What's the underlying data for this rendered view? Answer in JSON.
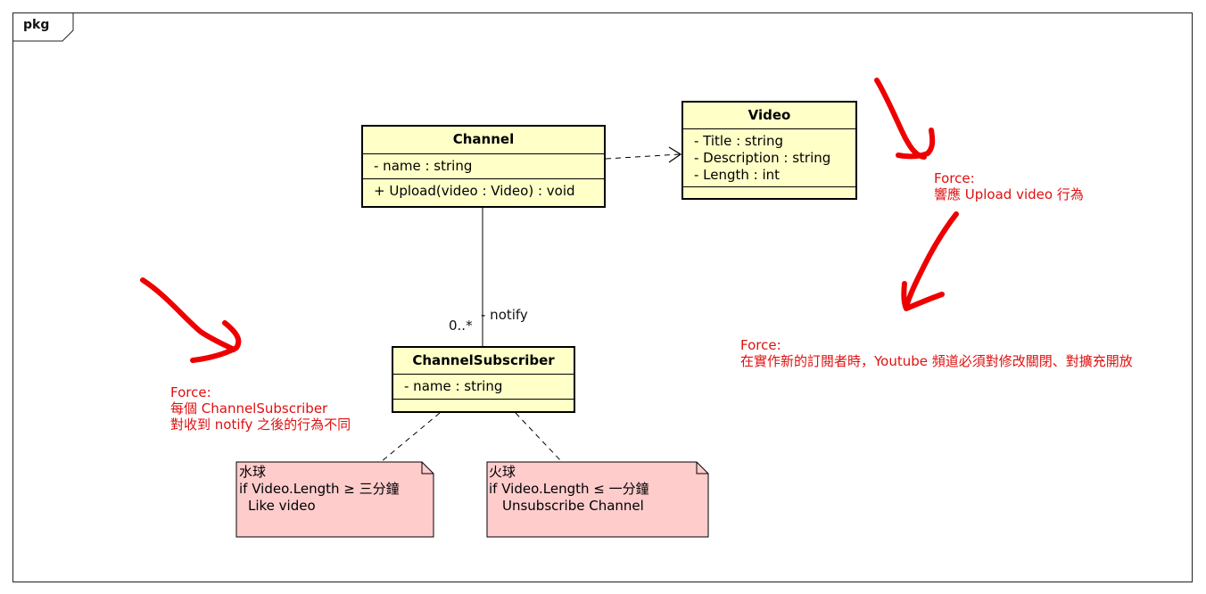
{
  "frame": {
    "label": "pkg"
  },
  "classes": {
    "channel": {
      "name": "Channel",
      "attributes": [
        "- name : string"
      ],
      "operations": [
        "+ Upload(video : Video) : void"
      ]
    },
    "video": {
      "name": "Video",
      "attributes": [
        "- Title : string",
        "- Description : string",
        "- Length : int"
      ],
      "operations": []
    },
    "subscriber": {
      "name": "ChannelSubscriber",
      "attributes": [
        "- name : string"
      ],
      "operations": []
    }
  },
  "association": {
    "role": "- notify",
    "multiplicity": "0..*"
  },
  "notes": {
    "water": [
      "水球",
      "if Video.Length ≥ 三分鐘",
      "Like video"
    ],
    "fire": [
      "火球",
      "if Video.Length ≤ 一分鐘",
      "Unsubscribe Channel"
    ]
  },
  "annotations": {
    "force_subscriber": [
      "Force:",
      "每個 ChannelSubscriber",
      "對收到 notify 之後的行為不同"
    ],
    "force_upload": [
      "Force:",
      "響應 Upload video 行為"
    ],
    "force_open_closed": [
      "Force:",
      "在實作新的訂閱者時，Youtube 頻道必須對修改關閉、對擴充開放"
    ]
  },
  "colors": {
    "class_fill": "#ffffc8",
    "note_fill": "#ffcccc",
    "annotation_red": "#e01010",
    "arrow_red": "#ee0000"
  }
}
